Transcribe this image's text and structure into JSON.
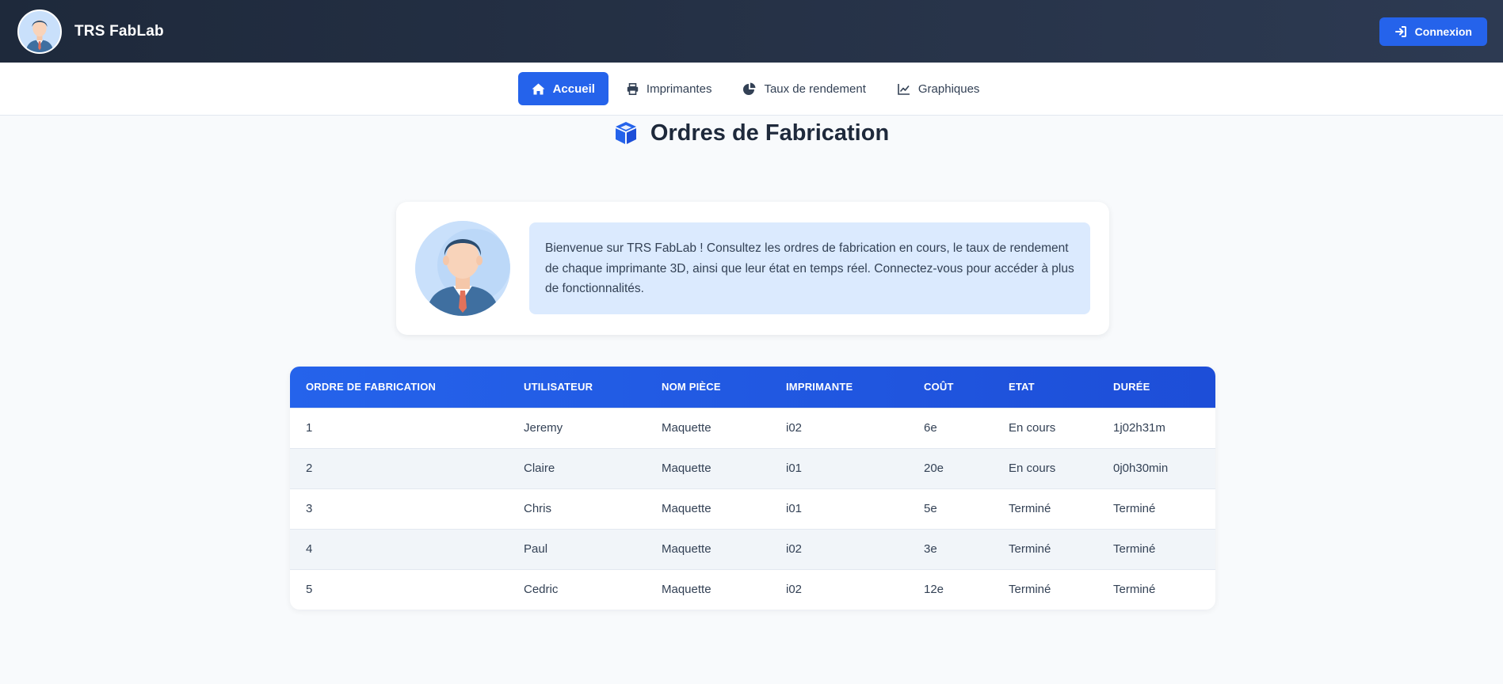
{
  "header": {
    "brand_title": "TRS FabLab",
    "login_label": "Connexion",
    "accent": "#2563eb",
    "background": "#1e293b"
  },
  "nav": {
    "items": [
      {
        "label": "Accueil",
        "icon": "home-icon",
        "active": true
      },
      {
        "label": "Imprimantes",
        "icon": "printer-icon",
        "active": false
      },
      {
        "label": "Taux de rendement",
        "icon": "pie-chart-icon",
        "active": false
      },
      {
        "label": "Graphiques",
        "icon": "line-chart-icon",
        "active": false
      }
    ]
  },
  "page": {
    "title": "Ordres de Fabrication",
    "title_icon": "cube-icon"
  },
  "welcome": {
    "text": "Bienvenue sur TRS FabLab ! Consultez les ordres de fabrication en cours, le taux de rendement de chaque imprimante 3D, ainsi que leur état en temps réel. Connectez-vous pour accéder à plus de fonctionnalités."
  },
  "table": {
    "headers": [
      "ORDRE DE FABRICATION",
      "UTILISATEUR",
      "NOM PIÈCE",
      "IMPRIMANTE",
      "COÛT",
      "ETAT",
      "DURÉE"
    ],
    "rows": [
      [
        "1",
        "Jeremy",
        "Maquette",
        "i02",
        "6e",
        "En cours",
        "1j02h31m"
      ],
      [
        "2",
        "Claire",
        "Maquette",
        "i01",
        "20e",
        "En cours",
        "0j0h30min"
      ],
      [
        "3",
        "Chris",
        "Maquette",
        "i01",
        "5e",
        "Terminé",
        "Terminé"
      ],
      [
        "4",
        "Paul",
        "Maquette",
        "i02",
        "3e",
        "Terminé",
        "Terminé"
      ],
      [
        "5",
        "Cedric",
        "Maquette",
        "i02",
        "12e",
        "Terminé",
        "Terminé"
      ]
    ]
  }
}
